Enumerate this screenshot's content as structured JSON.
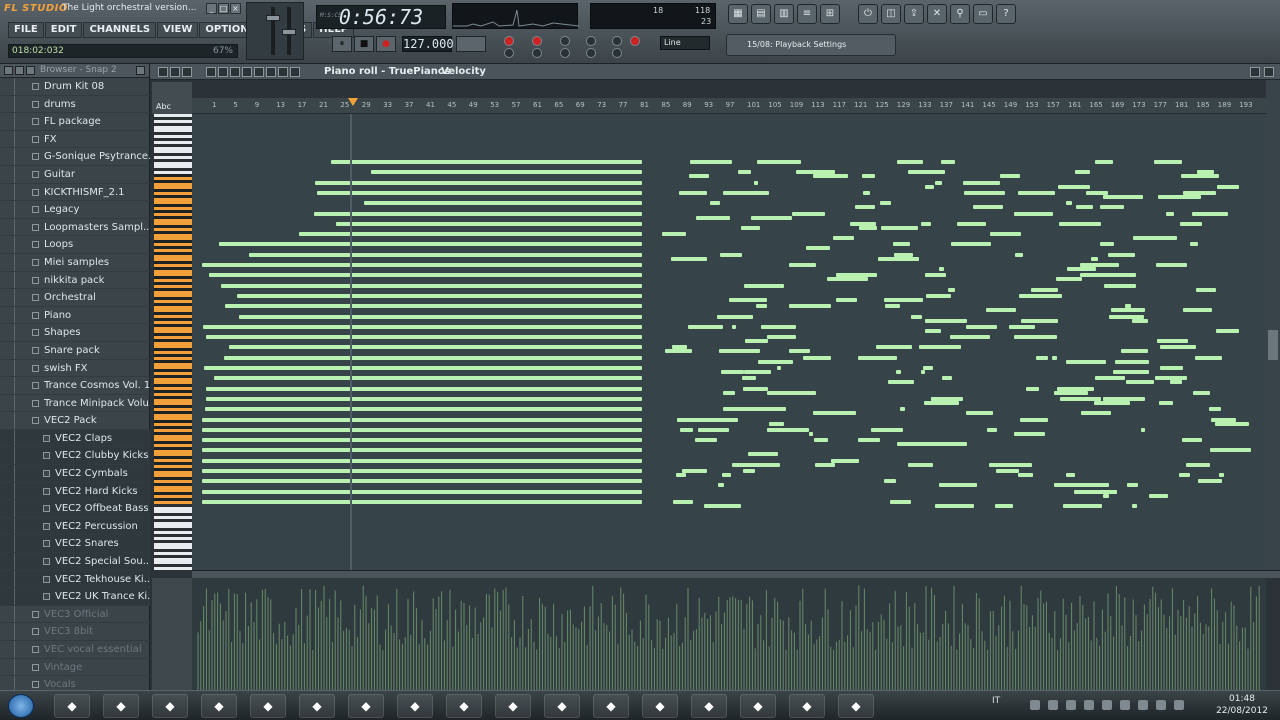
{
  "window": {
    "app_name": "FL STUDIO",
    "title": "The Light orchestral version...",
    "btn_min": "_",
    "btn_max": "□",
    "btn_close": "×"
  },
  "menu": [
    "FILE",
    "EDIT",
    "CHANNELS",
    "VIEW",
    "OPTIONS",
    "TOOLS",
    "HELP"
  ],
  "hint_panel": {
    "text": "018:02:032",
    "percent": "67%"
  },
  "transport": {
    "time_display": "0:56:73",
    "time_unit": "M:S:CS",
    "tempo": "127.000",
    "play_icon": "⏸",
    "stop_icon": "■",
    "rec_icon": "●"
  },
  "cpu_meter": {
    "value_a": "18",
    "value_b": "118",
    "value_c": "23"
  },
  "snap": {
    "line_label": "Line"
  },
  "hint_bar": {
    "text": "15/08: Playback Settings"
  },
  "browser": {
    "title": "Browser - Snap 2",
    "items": [
      {
        "label": "Drum Kit 08",
        "sub": false,
        "dim": false
      },
      {
        "label": "drums",
        "sub": false,
        "dim": false
      },
      {
        "label": "FL package",
        "sub": false,
        "dim": false
      },
      {
        "label": "FX",
        "sub": false,
        "dim": false
      },
      {
        "label": "G-Sonique Psytrance...",
        "sub": false,
        "dim": false
      },
      {
        "label": "Guitar",
        "sub": false,
        "dim": false
      },
      {
        "label": "KICKTHISMF_2.1",
        "sub": false,
        "dim": false
      },
      {
        "label": "Legacy",
        "sub": false,
        "dim": false
      },
      {
        "label": "Loopmasters Sampl...",
        "sub": false,
        "dim": false
      },
      {
        "label": "Loops",
        "sub": false,
        "dim": false
      },
      {
        "label": "Miei samples",
        "sub": false,
        "dim": false
      },
      {
        "label": "nikkita pack",
        "sub": false,
        "dim": false
      },
      {
        "label": "Orchestral",
        "sub": false,
        "dim": false
      },
      {
        "label": "Piano",
        "sub": false,
        "dim": false
      },
      {
        "label": "Shapes",
        "sub": false,
        "dim": false
      },
      {
        "label": "Snare pack",
        "sub": false,
        "dim": false
      },
      {
        "label": "swish FX",
        "sub": false,
        "dim": false
      },
      {
        "label": "Trance Cosmos Vol. 1",
        "sub": false,
        "dim": false
      },
      {
        "label": "Trance Minipack Volu...",
        "sub": false,
        "dim": false
      },
      {
        "label": "VEC2 Pack",
        "sub": false,
        "dim": false
      },
      {
        "label": "VEC2 Claps",
        "sub": true,
        "dim": false
      },
      {
        "label": "VEC2 Clubby Kicks",
        "sub": true,
        "dim": false
      },
      {
        "label": "VEC2 Cymbals",
        "sub": true,
        "dim": false
      },
      {
        "label": "VEC2 Hard Kicks",
        "sub": true,
        "dim": false
      },
      {
        "label": "VEC2 Offbeat Bass",
        "sub": true,
        "dim": false
      },
      {
        "label": "VEC2 Percussion",
        "sub": true,
        "dim": false
      },
      {
        "label": "VEC2 Snares",
        "sub": true,
        "dim": false
      },
      {
        "label": "VEC2 Special Sou...",
        "sub": true,
        "dim": false
      },
      {
        "label": "VEC2 Tekhouse Ki...",
        "sub": true,
        "dim": false
      },
      {
        "label": "VEC2 UK Trance Ki...",
        "sub": true,
        "dim": false
      },
      {
        "label": "VEC3 Official",
        "sub": false,
        "dim": true
      },
      {
        "label": "VEC3 8bit",
        "sub": false,
        "dim": true
      },
      {
        "label": "VEC vocal essential",
        "sub": false,
        "dim": true
      },
      {
        "label": "Vintage",
        "sub": false,
        "dim": true
      },
      {
        "label": "Vocals",
        "sub": false,
        "dim": true
      }
    ]
  },
  "piano_roll": {
    "title": "Piano roll - TruePianos",
    "target": "Velocity",
    "key_label": "Abc",
    "ruler_ticks": [
      "1",
      "5",
      "9",
      "13",
      "17",
      "21",
      "25",
      "29",
      "33",
      "37",
      "41",
      "45",
      "49",
      "53",
      "57",
      "61",
      "65",
      "69",
      "73",
      "77",
      "81",
      "85",
      "89",
      "93",
      "97",
      "101",
      "105",
      "109",
      "113",
      "117",
      "121",
      "125",
      "129",
      "133",
      "137",
      "141",
      "145",
      "149",
      "153",
      "157",
      "161",
      "165",
      "169",
      "173",
      "177",
      "181",
      "185",
      "189",
      "193"
    ]
  },
  "taskbar": {
    "apps": [
      "uTorrent",
      "Minecraft",
      "Manager",
      "Explorer",
      "Chrome",
      "Media",
      "Tools",
      "Skype",
      "Network",
      "Folder",
      "Burn",
      "FL Studio",
      "Live",
      "Audio",
      "Box",
      "Notes",
      "App"
    ],
    "language": "IT",
    "time": "01:48",
    "date": "22/08/2012"
  },
  "colors": {
    "accent": "#f2a13a",
    "note": "#b9f2b0",
    "grid": "#36444a"
  }
}
